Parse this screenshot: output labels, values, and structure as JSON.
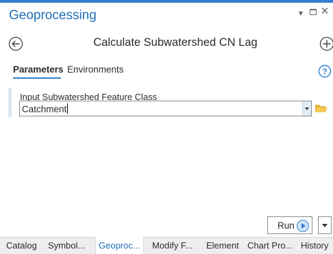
{
  "pane": {
    "title": "Geoprocessing",
    "accent_color": "#2f7fd1",
    "title_color": "#1f6fb8"
  },
  "window_controls": {
    "menu_icon": "chevron-down-icon",
    "maximize_icon": "maximize-icon",
    "close_glyph": "✕"
  },
  "tool": {
    "back_icon": "back-arrow-icon",
    "title": "Calculate Subwatershed CN Lag",
    "add_icon": "add-circle-icon"
  },
  "tabs": [
    {
      "label": "Parameters",
      "active": true
    },
    {
      "label": "Environments",
      "active": false
    }
  ],
  "help_icon": "help-icon",
  "parameters": [
    {
      "label": "Input Subwatershed Feature Class",
      "value": "Catchment",
      "browse_icon": "folder-icon"
    }
  ],
  "run": {
    "label": "Run",
    "icon": "play-circle-icon"
  },
  "dock_tabs": [
    {
      "label": "Catalog",
      "active": false
    },
    {
      "label": "Symbol...",
      "active": false
    },
    {
      "label": "Geoproc...",
      "active": true
    },
    {
      "label": "Modify F...",
      "active": false
    },
    {
      "label": "Element",
      "active": false
    },
    {
      "label": "Chart Pro...",
      "active": false
    },
    {
      "label": "History",
      "active": false
    }
  ]
}
